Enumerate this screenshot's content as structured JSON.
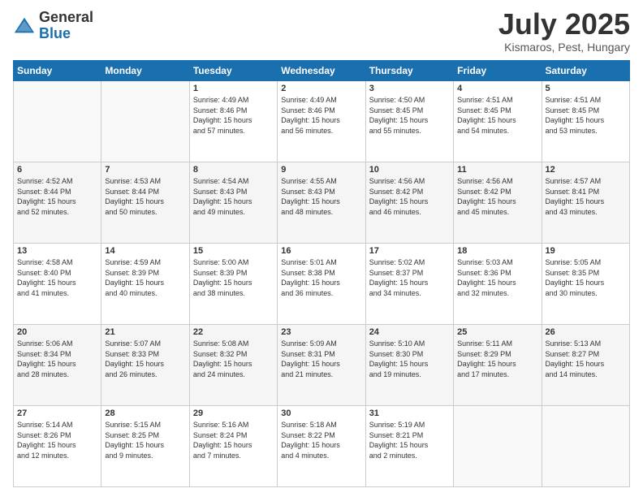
{
  "header": {
    "logo_general": "General",
    "logo_blue": "Blue",
    "month_title": "July 2025",
    "subtitle": "Kismaros, Pest, Hungary"
  },
  "days_of_week": [
    "Sunday",
    "Monday",
    "Tuesday",
    "Wednesday",
    "Thursday",
    "Friday",
    "Saturday"
  ],
  "weeks": [
    [
      {
        "day": "",
        "info": ""
      },
      {
        "day": "",
        "info": ""
      },
      {
        "day": "1",
        "info": "Sunrise: 4:49 AM\nSunset: 8:46 PM\nDaylight: 15 hours\nand 57 minutes."
      },
      {
        "day": "2",
        "info": "Sunrise: 4:49 AM\nSunset: 8:46 PM\nDaylight: 15 hours\nand 56 minutes."
      },
      {
        "day": "3",
        "info": "Sunrise: 4:50 AM\nSunset: 8:45 PM\nDaylight: 15 hours\nand 55 minutes."
      },
      {
        "day": "4",
        "info": "Sunrise: 4:51 AM\nSunset: 8:45 PM\nDaylight: 15 hours\nand 54 minutes."
      },
      {
        "day": "5",
        "info": "Sunrise: 4:51 AM\nSunset: 8:45 PM\nDaylight: 15 hours\nand 53 minutes."
      }
    ],
    [
      {
        "day": "6",
        "info": "Sunrise: 4:52 AM\nSunset: 8:44 PM\nDaylight: 15 hours\nand 52 minutes."
      },
      {
        "day": "7",
        "info": "Sunrise: 4:53 AM\nSunset: 8:44 PM\nDaylight: 15 hours\nand 50 minutes."
      },
      {
        "day": "8",
        "info": "Sunrise: 4:54 AM\nSunset: 8:43 PM\nDaylight: 15 hours\nand 49 minutes."
      },
      {
        "day": "9",
        "info": "Sunrise: 4:55 AM\nSunset: 8:43 PM\nDaylight: 15 hours\nand 48 minutes."
      },
      {
        "day": "10",
        "info": "Sunrise: 4:56 AM\nSunset: 8:42 PM\nDaylight: 15 hours\nand 46 minutes."
      },
      {
        "day": "11",
        "info": "Sunrise: 4:56 AM\nSunset: 8:42 PM\nDaylight: 15 hours\nand 45 minutes."
      },
      {
        "day": "12",
        "info": "Sunrise: 4:57 AM\nSunset: 8:41 PM\nDaylight: 15 hours\nand 43 minutes."
      }
    ],
    [
      {
        "day": "13",
        "info": "Sunrise: 4:58 AM\nSunset: 8:40 PM\nDaylight: 15 hours\nand 41 minutes."
      },
      {
        "day": "14",
        "info": "Sunrise: 4:59 AM\nSunset: 8:39 PM\nDaylight: 15 hours\nand 40 minutes."
      },
      {
        "day": "15",
        "info": "Sunrise: 5:00 AM\nSunset: 8:39 PM\nDaylight: 15 hours\nand 38 minutes."
      },
      {
        "day": "16",
        "info": "Sunrise: 5:01 AM\nSunset: 8:38 PM\nDaylight: 15 hours\nand 36 minutes."
      },
      {
        "day": "17",
        "info": "Sunrise: 5:02 AM\nSunset: 8:37 PM\nDaylight: 15 hours\nand 34 minutes."
      },
      {
        "day": "18",
        "info": "Sunrise: 5:03 AM\nSunset: 8:36 PM\nDaylight: 15 hours\nand 32 minutes."
      },
      {
        "day": "19",
        "info": "Sunrise: 5:05 AM\nSunset: 8:35 PM\nDaylight: 15 hours\nand 30 minutes."
      }
    ],
    [
      {
        "day": "20",
        "info": "Sunrise: 5:06 AM\nSunset: 8:34 PM\nDaylight: 15 hours\nand 28 minutes."
      },
      {
        "day": "21",
        "info": "Sunrise: 5:07 AM\nSunset: 8:33 PM\nDaylight: 15 hours\nand 26 minutes."
      },
      {
        "day": "22",
        "info": "Sunrise: 5:08 AM\nSunset: 8:32 PM\nDaylight: 15 hours\nand 24 minutes."
      },
      {
        "day": "23",
        "info": "Sunrise: 5:09 AM\nSunset: 8:31 PM\nDaylight: 15 hours\nand 21 minutes."
      },
      {
        "day": "24",
        "info": "Sunrise: 5:10 AM\nSunset: 8:30 PM\nDaylight: 15 hours\nand 19 minutes."
      },
      {
        "day": "25",
        "info": "Sunrise: 5:11 AM\nSunset: 8:29 PM\nDaylight: 15 hours\nand 17 minutes."
      },
      {
        "day": "26",
        "info": "Sunrise: 5:13 AM\nSunset: 8:27 PM\nDaylight: 15 hours\nand 14 minutes."
      }
    ],
    [
      {
        "day": "27",
        "info": "Sunrise: 5:14 AM\nSunset: 8:26 PM\nDaylight: 15 hours\nand 12 minutes."
      },
      {
        "day": "28",
        "info": "Sunrise: 5:15 AM\nSunset: 8:25 PM\nDaylight: 15 hours\nand 9 minutes."
      },
      {
        "day": "29",
        "info": "Sunrise: 5:16 AM\nSunset: 8:24 PM\nDaylight: 15 hours\nand 7 minutes."
      },
      {
        "day": "30",
        "info": "Sunrise: 5:18 AM\nSunset: 8:22 PM\nDaylight: 15 hours\nand 4 minutes."
      },
      {
        "day": "31",
        "info": "Sunrise: 5:19 AM\nSunset: 8:21 PM\nDaylight: 15 hours\nand 2 minutes."
      },
      {
        "day": "",
        "info": ""
      },
      {
        "day": "",
        "info": ""
      }
    ]
  ]
}
